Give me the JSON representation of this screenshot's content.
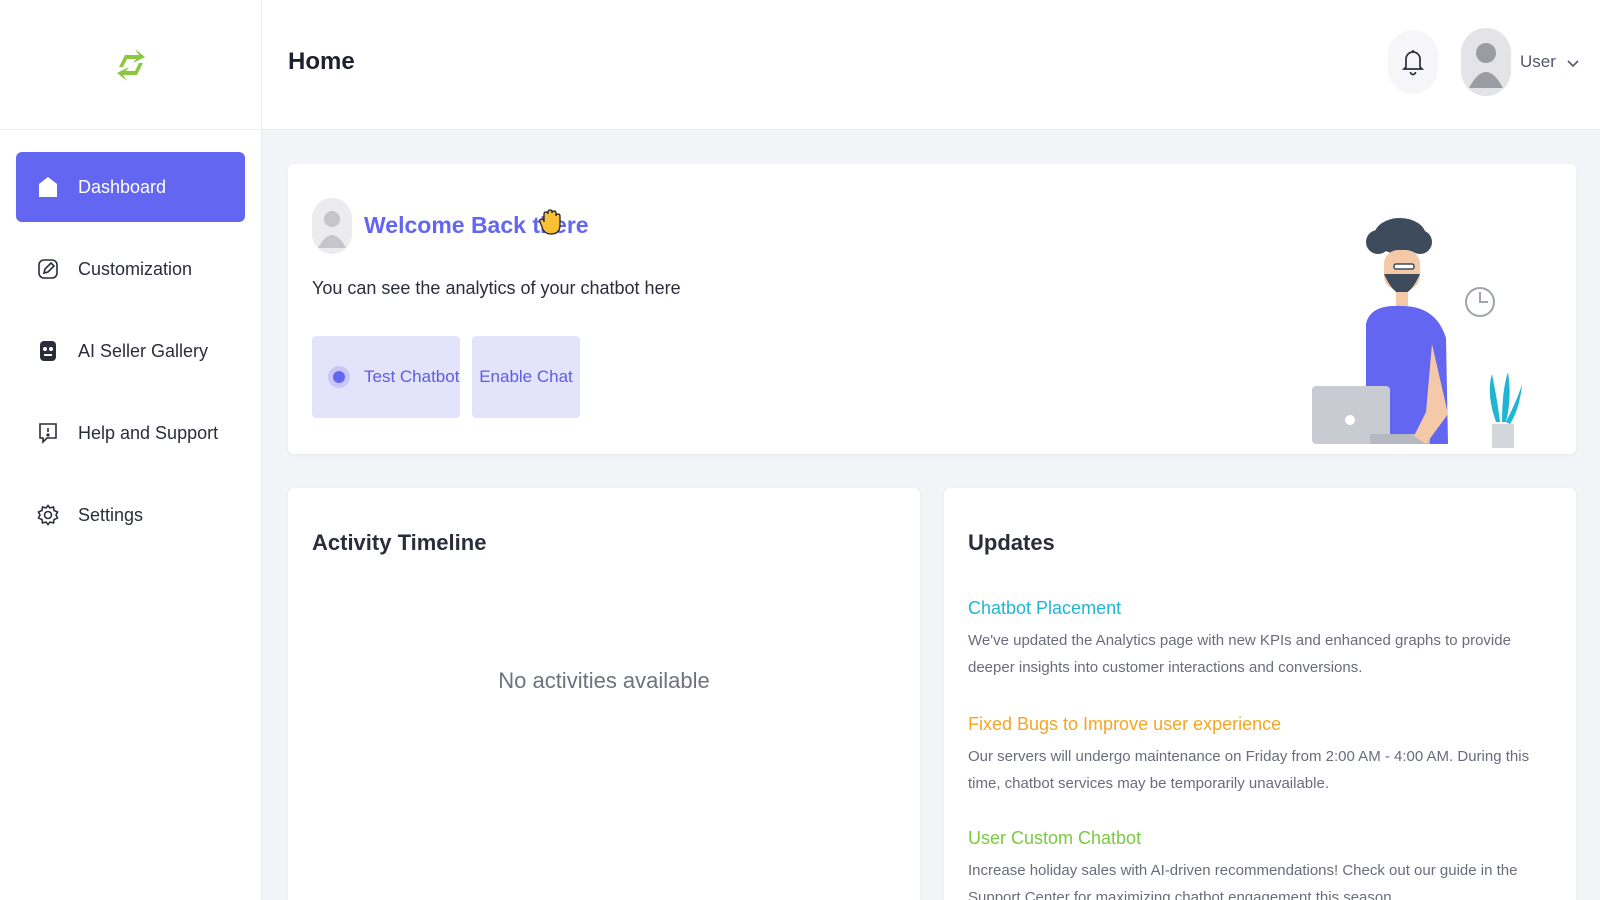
{
  "header": {
    "title": "Home",
    "user_name": "User"
  },
  "sidebar": {
    "items": [
      {
        "label": "Dashboard",
        "icon": "home-icon",
        "active": true
      },
      {
        "label": "Customization",
        "icon": "edit-icon"
      },
      {
        "label": "AI Seller Gallery",
        "icon": "robot-icon"
      },
      {
        "label": "Help and Support",
        "icon": "help-icon"
      },
      {
        "label": "Settings",
        "icon": "gear-icon"
      }
    ]
  },
  "welcome": {
    "title": "Welcome Back there",
    "subtitle": "You can see the analytics of your chatbot here",
    "test_button": "Test Chatbot",
    "enable_button": "Enable Chat"
  },
  "timeline": {
    "title": "Activity Timeline",
    "empty_text": "No activities available"
  },
  "updates": {
    "title": "Updates",
    "items": [
      {
        "title": "Chatbot Placement",
        "color": "#1fb6d3",
        "desc": "We've updated the Analytics page with new KPIs and enhanced graphs to provide deeper insights into customer interactions and conversions."
      },
      {
        "title": "Fixed Bugs to Improve user experience",
        "color": "#f5a623",
        "desc": "Our servers will undergo maintenance on Friday from 2:00 AM - 4:00 AM. During this time, chatbot services may be temporarily unavailable."
      },
      {
        "title": "User Custom Chatbot",
        "color": "#7ac943",
        "desc": "Increase holiday sales with AI-driven recommendations! Check out our guide in the Support Center for maximizing chatbot engagement this season."
      }
    ]
  },
  "colors": {
    "accent": "#6366f1",
    "logo": "#8dc63f"
  }
}
